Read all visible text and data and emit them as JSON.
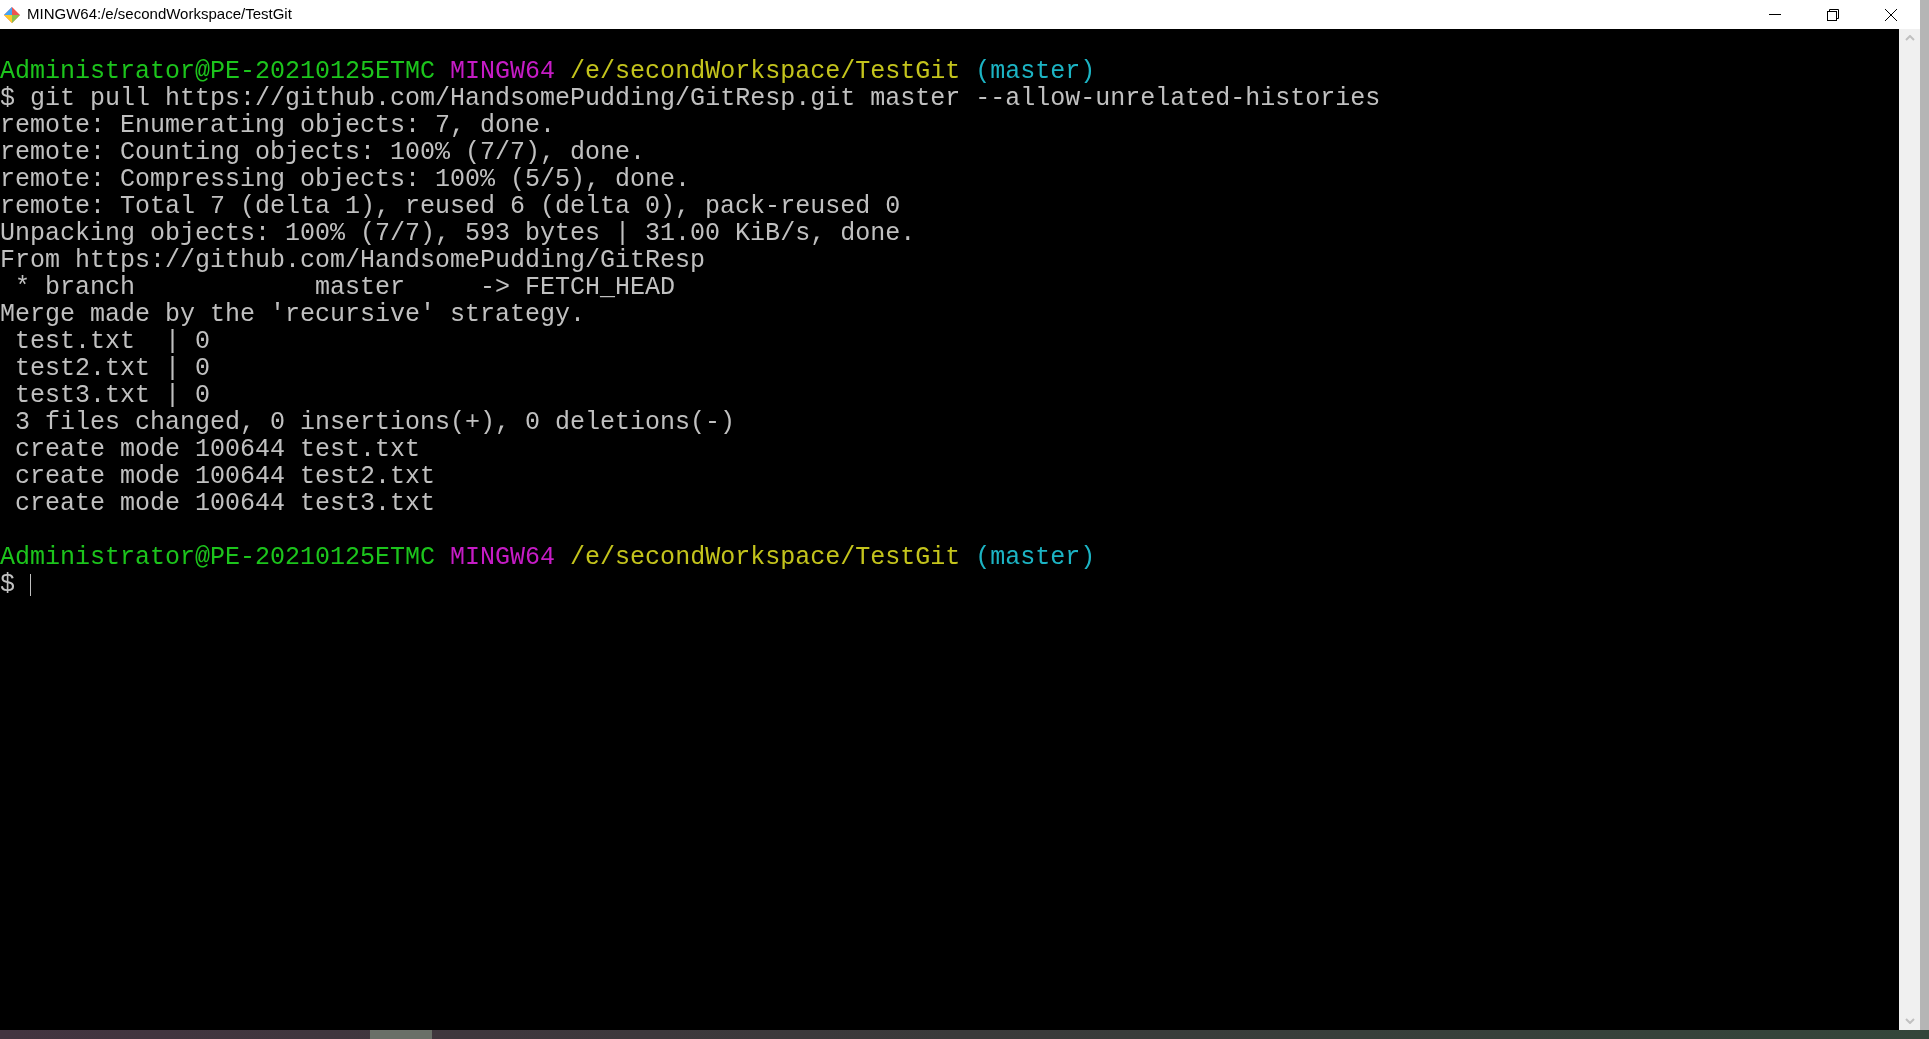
{
  "window": {
    "title": "MINGW64:/e/secondWorkspace/TestGit"
  },
  "terminal": {
    "blocks": [
      {
        "prompt": [
          {
            "kind": "user",
            "text": "Administrator@PE-20210125ETMC"
          },
          {
            "kind": "shell",
            "text": "MINGW64"
          },
          {
            "kind": "path",
            "text": "/e/secondWorkspace/TestGit"
          },
          {
            "kind": "branch",
            "text": "(master)"
          }
        ],
        "input": {
          "symbol": "$",
          "command": "git pull https://github.com/HandsomePudding/GitResp.git master --allow-unrelated-histories",
          "cursor": false
        },
        "output": [
          "remote: Enumerating objects: 7, done.",
          "remote: Counting objects: 100% (7/7), done.",
          "remote: Compressing objects: 100% (5/5), done.",
          "remote: Total 7 (delta 1), reused 6 (delta 0), pack-reused 0",
          "Unpacking objects: 100% (7/7), 593 bytes | 31.00 KiB/s, done.",
          "From https://github.com/HandsomePudding/GitResp",
          " * branch            master     -> FETCH_HEAD",
          "Merge made by the 'recursive' strategy.",
          " test.txt  | 0",
          " test2.txt | 0",
          " test3.txt | 0",
          " 3 files changed, 0 insertions(+), 0 deletions(-)",
          " create mode 100644 test.txt",
          " create mode 100644 test2.txt",
          " create mode 100644 test3.txt"
        ]
      },
      {
        "prompt": [
          {
            "kind": "user",
            "text": "Administrator@PE-20210125ETMC"
          },
          {
            "kind": "shell",
            "text": "MINGW64"
          },
          {
            "kind": "path",
            "text": "/e/secondWorkspace/TestGit"
          },
          {
            "kind": "branch",
            "text": "(master)"
          }
        ],
        "input": {
          "symbol": "$",
          "cursor": true
        }
      }
    ]
  }
}
